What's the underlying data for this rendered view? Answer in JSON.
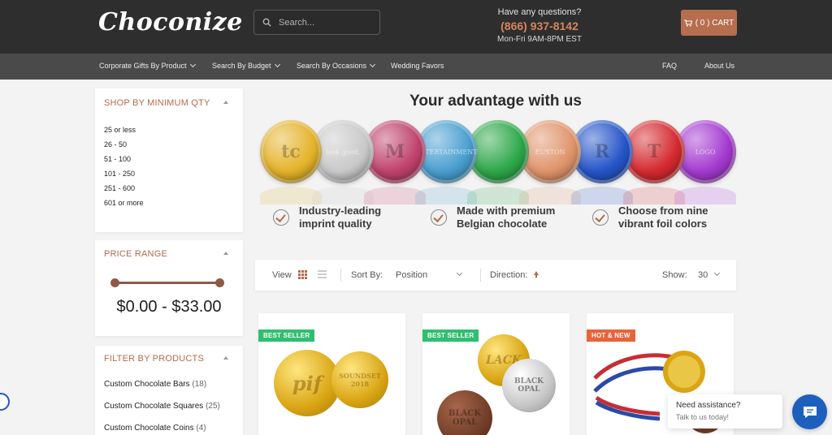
{
  "header": {
    "logo": "Choconize",
    "search": {
      "placeholder": "Search..."
    },
    "contact": {
      "question": "Have any questions?",
      "phone": "(866) 937-8142",
      "hours": "Mon-Fri 9AM-8PM EST"
    },
    "cart": {
      "label": "( 0 ) CART"
    }
  },
  "nav": {
    "items": [
      {
        "label": "Corporate Gifts By Product",
        "dropdown": true
      },
      {
        "label": "Search By Budget",
        "dropdown": true
      },
      {
        "label": "Search By Occasions",
        "dropdown": true
      },
      {
        "label": "Wedding Favors",
        "dropdown": false
      }
    ],
    "right": [
      {
        "label": "FAQ"
      },
      {
        "label": "About Us"
      }
    ]
  },
  "sidebar": {
    "min_qty": {
      "title": "SHOP BY MINIMUM QTY",
      "options": [
        "25 or less",
        "26 - 50",
        "51 - 100",
        "101 - 250",
        "251 - 600",
        "601 or more"
      ]
    },
    "price": {
      "title": "PRICE RANGE",
      "value": "$0.00 - $33.00",
      "min_fraction": 0,
      "max_fraction": 1
    },
    "products": {
      "title": "FILTER BY PRODUCTS",
      "items": [
        {
          "name": "Custom Chocolate Bars",
          "count": "(18)"
        },
        {
          "name": "Custom Chocolate Squares",
          "count": "(25)"
        },
        {
          "name": "Custom Chocolate Coins",
          "count": "(4)"
        }
      ]
    }
  },
  "advantage": {
    "title": "Your advantage with us",
    "coins": [
      {
        "color": "#e5b32a",
        "mark": "tc"
      },
      {
        "color": "#c9c9c9",
        "mark": "look good."
      },
      {
        "color": "#c0436d",
        "mark": "M"
      },
      {
        "color": "#4a9fd0",
        "mark": "ENTERTAINMENT"
      },
      {
        "color": "#2ea84a",
        "mark": ""
      },
      {
        "color": "#e0946b",
        "mark": "EUSTON"
      },
      {
        "color": "#2555c8",
        "mark": "R"
      },
      {
        "color": "#d42a30",
        "mark": "T"
      },
      {
        "color": "#a43ad0",
        "mark": "LOGO"
      }
    ],
    "features": [
      {
        "line1": "Industry-leading",
        "line2": "imprint quality"
      },
      {
        "line1": "Made with premium",
        "line2": "Belgian chocolate"
      },
      {
        "line1": "Choose from nine",
        "line2": "vibrant foil colors"
      }
    ]
  },
  "toolbar": {
    "view_label": "View",
    "sort_label": "Sort By:",
    "sort_value": "Position",
    "direction_label": "Direction:",
    "show_label": "Show:",
    "show_value": "30"
  },
  "products": [
    {
      "badge": "BEST SELLER",
      "badge_color": "#2fbf71",
      "coin_texts": [
        "pif",
        "SOUNDSET 2018"
      ]
    },
    {
      "badge": "BEST SELLER",
      "badge_color": "#2fbf71",
      "coin_texts": [
        "LACK",
        "BLACK OPAL",
        "BLACK OPAL"
      ]
    },
    {
      "badge": "HOT & NEW",
      "badge_color": "#e8633a",
      "coin_texts": []
    }
  ],
  "chat": {
    "title": "Need assistance?",
    "subtitle": "Talk to us today!"
  }
}
